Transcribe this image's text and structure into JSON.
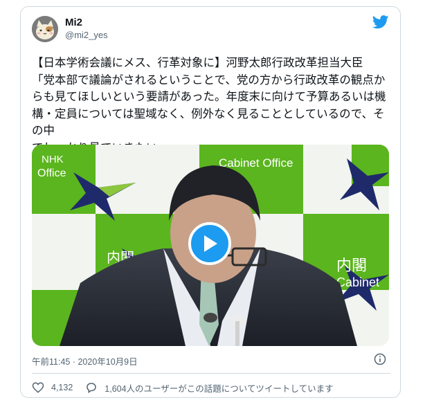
{
  "tweet": {
    "display_name": "Mi2",
    "handle": "@mi2_yes",
    "text": "【日本学術会議にメス、行革対象に】河野太郎行政改革担当大臣\n「党本部で議論がされるということで、党の方から行政改革の観点か\nらも見てほしいという要請があった。年度末に向けて予算あるいは機\n構・定員については聖域なく、例外なく見ることとしているので、その中\nでしっかり見ていきたい」",
    "timestamp": "午前11:45 · 2020年10月9日",
    "like_count": "4,132",
    "conversation_text": "1,604人のユーザーがこの話題についてツイートしています"
  },
  "video": {
    "sign_left_top": "NHK",
    "sign_left_bottom": "Office",
    "sign_center_top": "Cabinet Office",
    "sign_right_jp": "内閣",
    "sign_right_en": "Cabinet",
    "sign_left_jp": "内閣"
  },
  "colors": {
    "accent": "#1d9bf0",
    "backdrop_green": "#5bb51e",
    "backdrop_navy": "#1f2a6b"
  },
  "icons": [
    "twitter-bird-icon",
    "play-icon",
    "info-icon",
    "heart-icon",
    "reply-icon"
  ]
}
